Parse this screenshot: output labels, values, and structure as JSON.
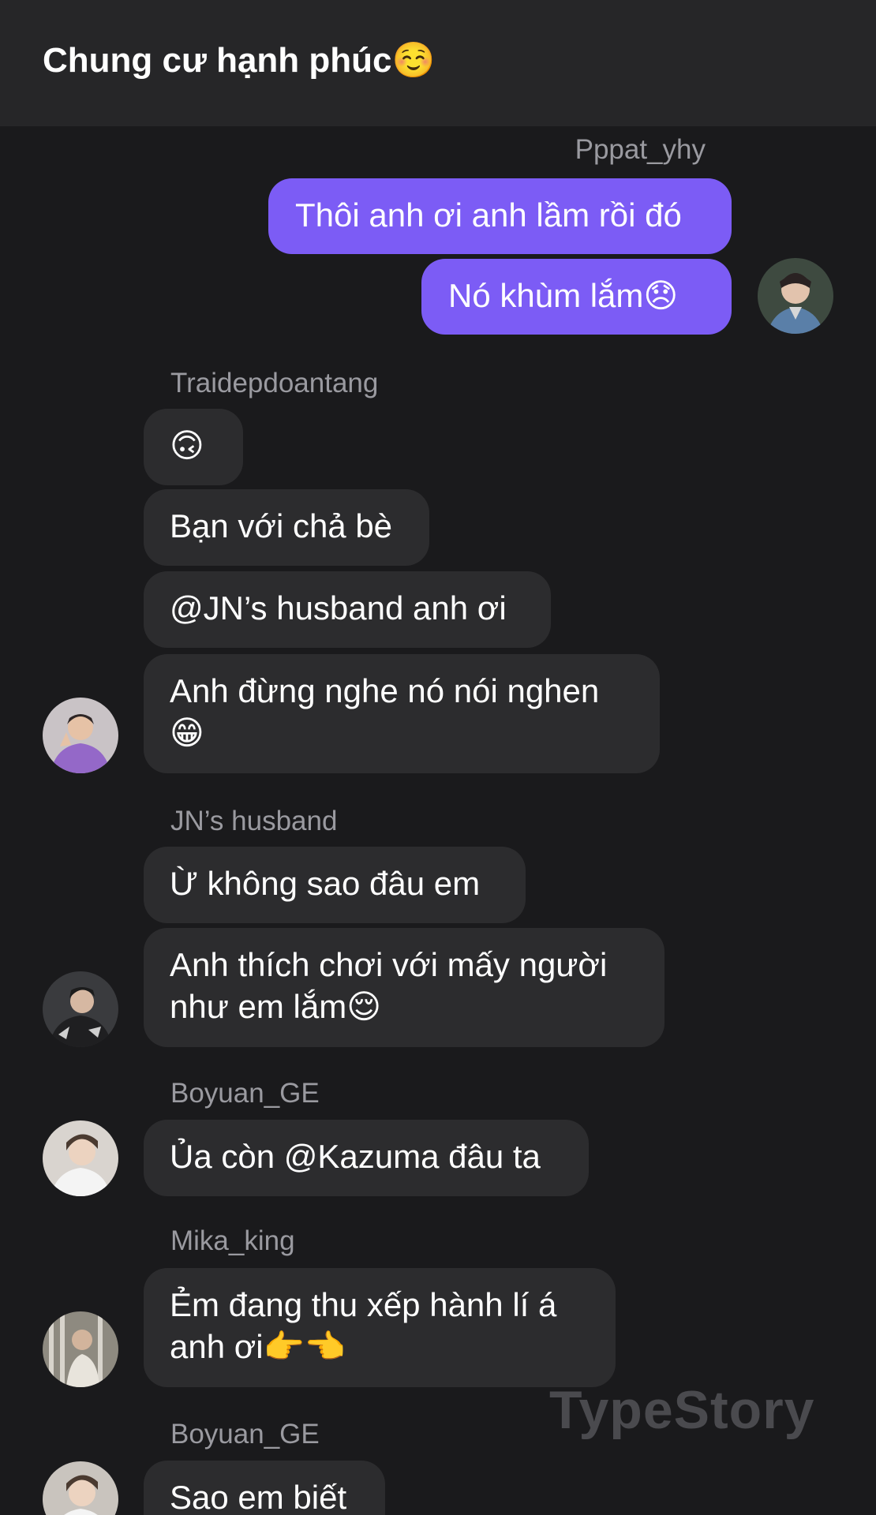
{
  "header": {
    "title": "Chung cư hạnh phúc",
    "title_emoji": "☺️"
  },
  "messages": [
    {
      "sender": "Pppat_yhy",
      "text": "Thôi anh ơi anh lầm rồi đó"
    },
    {
      "text": "Nó khùm lắm😞"
    },
    {
      "sender": "Traidepdoantang",
      "text": "🙃"
    },
    {
      "text": "Bạn với chả bè"
    },
    {
      "text": "@JN’s husband anh ơi"
    },
    {
      "text": "Anh đừng nghe nó nói nghen\n😁"
    },
    {
      "sender": "JN’s husband",
      "text": "Ừ không sao đâu em"
    },
    {
      "text": "Anh thích chơi với mấy người\nnhư em lắm😌"
    },
    {
      "sender": "Boyuan_GE",
      "text": "Ủa còn @Kazuma đâu ta"
    },
    {
      "sender": "Mika_king",
      "text": "Ẻm đang thu xếp hành lí á\nanh ơi👉👈"
    },
    {
      "sender": "Boyuan_GE",
      "text": "Sao em biết"
    }
  ],
  "watermark": "TypeStory",
  "colors": {
    "background": "#1a1a1c",
    "header": "#262628",
    "outgoing_bubble": "#7c5cf5",
    "incoming_bubble": "#2c2c2e",
    "sender_name": "#9a9aa0"
  },
  "icons": {
    "avatars": [
      "avatar-pppat",
      "avatar-traidepdoantang",
      "avatar-jn-husband",
      "avatar-boyuan",
      "avatar-mika",
      "avatar-boyuan"
    ]
  }
}
